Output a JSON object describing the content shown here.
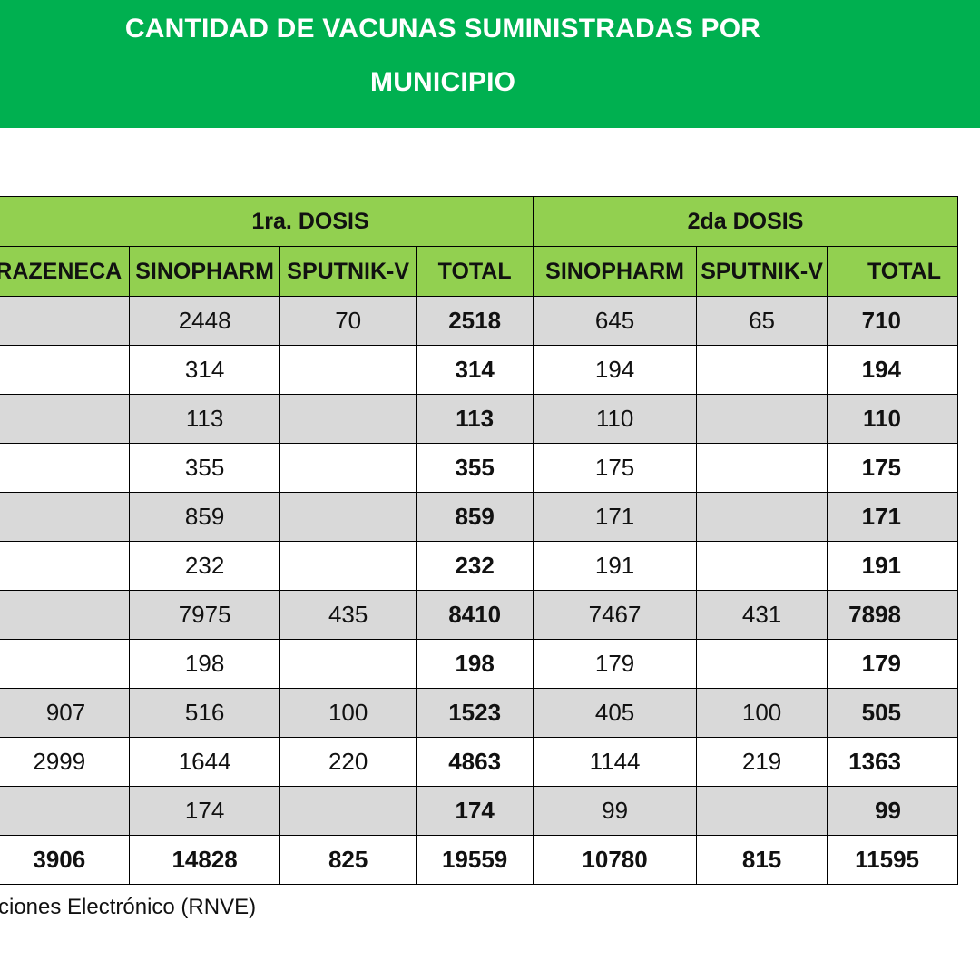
{
  "title": {
    "line1": "CANTIDAD DE VACUNAS SUMINISTRADAS POR",
    "line2": "MUNICIPIO"
  },
  "table": {
    "group_headers": {
      "first_dose": "1ra. DOSIS",
      "second_dose": "2da DOSIS"
    },
    "column_headers": [
      "TRAZENECA",
      "SINOPHARM",
      "SPUTNIK-V",
      "TOTAL",
      "SINOPHARM",
      "SPUTNIK-V",
      "TOTAL"
    ],
    "rows": [
      [
        "",
        "2448",
        "70",
        "2518",
        "645",
        "65",
        "710"
      ],
      [
        "",
        "314",
        "",
        "314",
        "194",
        "",
        "194"
      ],
      [
        "",
        "113",
        "",
        "113",
        "110",
        "",
        "110"
      ],
      [
        "",
        "355",
        "",
        "355",
        "175",
        "",
        "175"
      ],
      [
        "",
        "859",
        "",
        "859",
        "171",
        "",
        "171"
      ],
      [
        "",
        "232",
        "",
        "232",
        "191",
        "",
        "191"
      ],
      [
        "",
        "7975",
        "435",
        "8410",
        "7467",
        "431",
        "7898"
      ],
      [
        "",
        "198",
        "",
        "198",
        "179",
        "",
        "179"
      ],
      [
        "907",
        "516",
        "100",
        "1523",
        "405",
        "100",
        "505"
      ],
      [
        "2999",
        "1644",
        "220",
        "4863",
        "1144",
        "219",
        "1363"
      ],
      [
        "",
        "174",
        "",
        "174",
        "99",
        "",
        "99"
      ]
    ],
    "totals": [
      "3906",
      "14828",
      "825",
      "19559",
      "10780",
      "815",
      "11595"
    ]
  },
  "source_text": "ciones Electrónico (RNVE)",
  "colors": {
    "header_green": "#00b050",
    "table_header_green": "#92d050",
    "row_shade": "#d9d9d9"
  }
}
